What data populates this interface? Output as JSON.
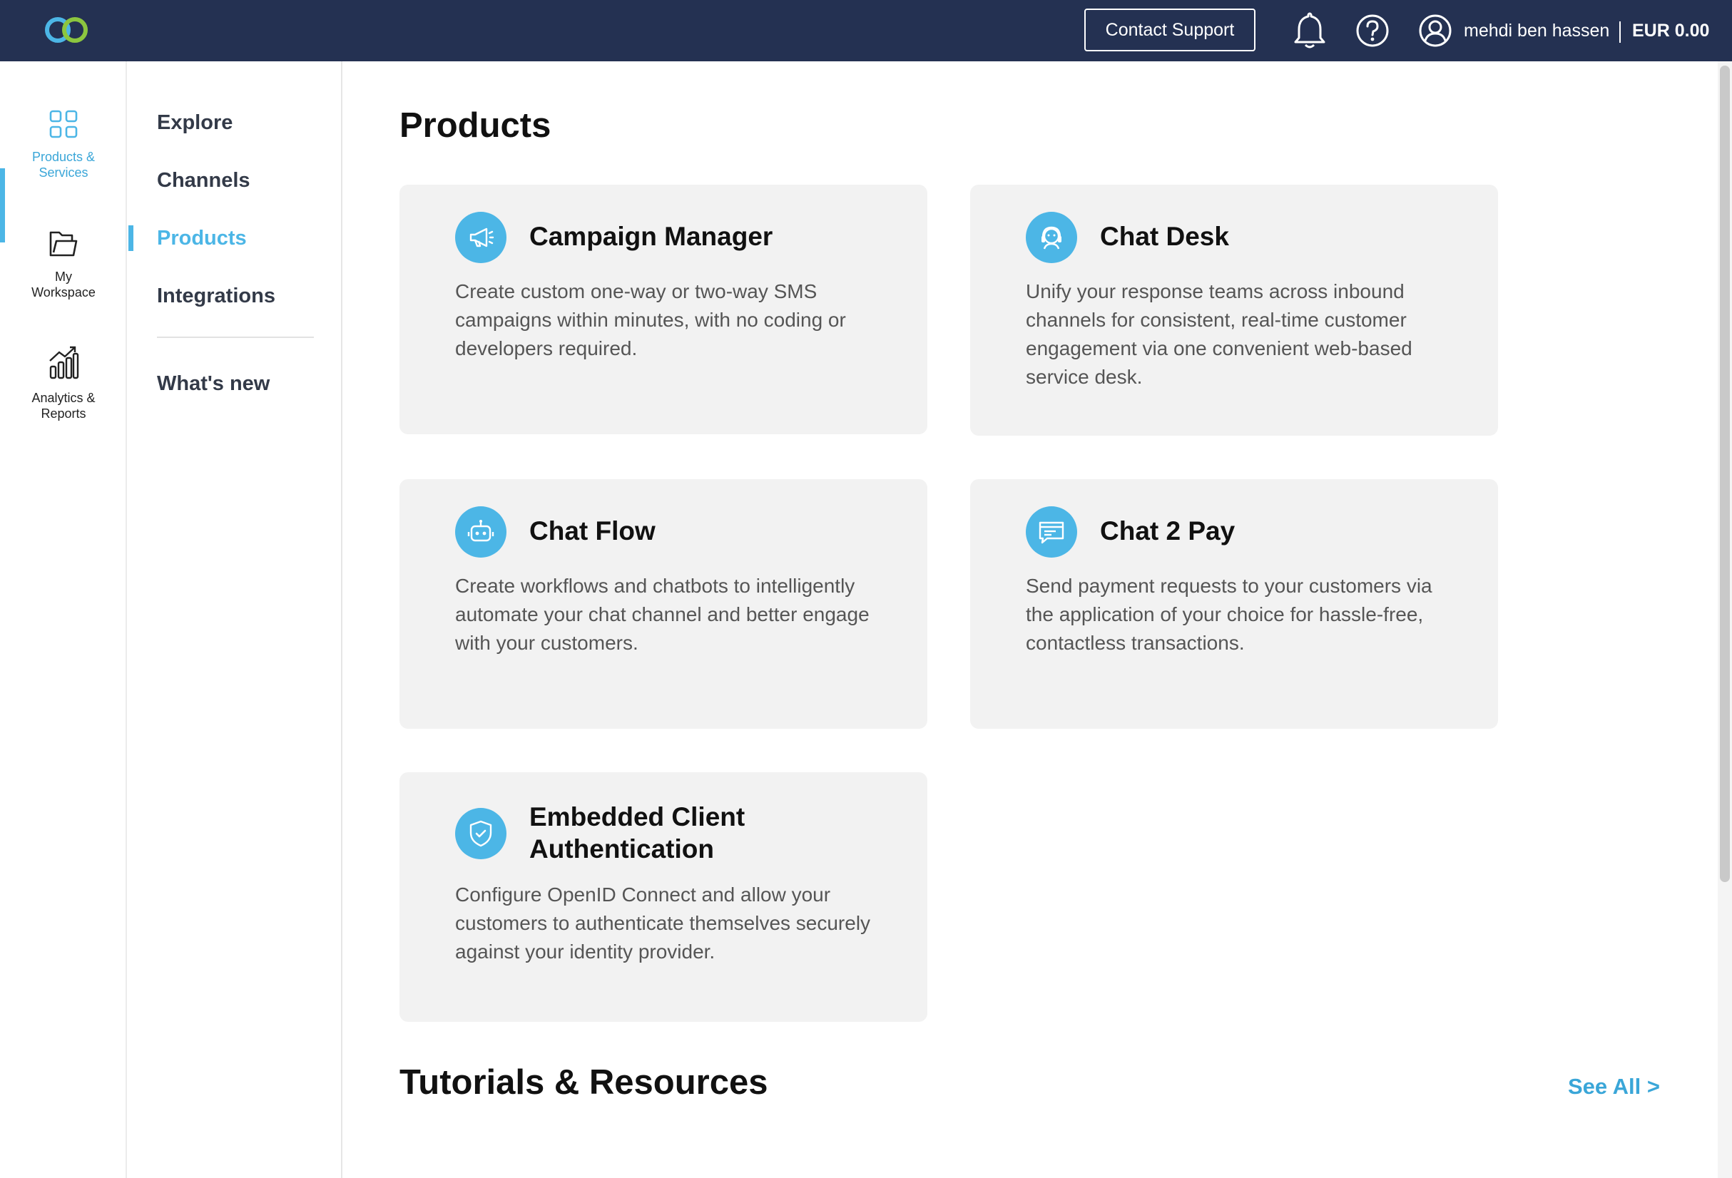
{
  "topbar": {
    "logo": "infinity-logo",
    "contact_label": "Contact Support",
    "user_name": "mehdi ben hassen",
    "balance": "EUR 0.00",
    "icons": [
      "bell-icon",
      "help-icon",
      "user-icon"
    ]
  },
  "rail": {
    "items": [
      {
        "label": "Products &\nServices",
        "icon": "grid-icon",
        "active": true
      },
      {
        "label": "My\nWorkspace",
        "icon": "folder-icon",
        "active": false
      },
      {
        "label": "Analytics &\nReports",
        "icon": "chart-icon",
        "active": false
      }
    ]
  },
  "subnav": {
    "items": [
      {
        "label": "Explore",
        "active": false
      },
      {
        "label": "Channels",
        "active": false
      },
      {
        "label": "Products",
        "active": true
      },
      {
        "label": "Integrations",
        "active": false
      },
      {
        "label": "What's new",
        "active": false
      }
    ]
  },
  "main": {
    "title": "Products",
    "cards": [
      {
        "title": "Campaign Manager",
        "description": "Create custom one-way or two-way SMS campaigns within minutes, with no coding or developers required.",
        "icon": "megaphone-icon"
      },
      {
        "title": "Chat Desk",
        "description": "Unify your response teams across inbound channels for consistent, real-time customer engagement via one convenient web-based service desk.",
        "icon": "agent-icon"
      },
      {
        "title": "Chat Flow",
        "description": "Create workflows and chatbots to intelligently automate your chat channel and better engage with your customers.",
        "icon": "robot-icon"
      },
      {
        "title": "Chat 2 Pay",
        "description": "Send payment requests to your customers via the application of your choice for hassle-free, contactless transactions.",
        "icon": "payment-chat-icon"
      },
      {
        "title": "Embedded Client Authentication",
        "description": "Configure OpenID Connect and allow your customers to authenticate themselves securely against your identity provider.",
        "icon": "shield-check-icon"
      }
    ],
    "tutorials_title": "Tutorials & Resources",
    "see_all_label": "See All >"
  },
  "colors": {
    "topbar": "#243152",
    "accent": "#4cb6e6",
    "card_bg": "#f2f2f2"
  }
}
